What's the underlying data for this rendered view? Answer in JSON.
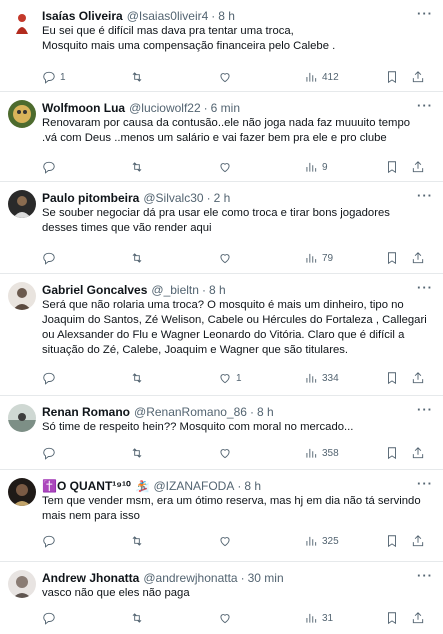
{
  "tweets": [
    {
      "name": "Isaías Oliveira",
      "handle": "@Isaias0liveir4",
      "time": "8 h",
      "lines": [
        "Eu sei que é difícil mas dava pra tentar uma troca,",
        "Mosquito mais uma compensação financeira pelo Calebe ."
      ],
      "replies": "1",
      "retweets": "",
      "likes": "",
      "views": "412",
      "avatar_color": "#b22b1e"
    },
    {
      "name": "Wolfmoon Lua",
      "handle": "@luciowolf22",
      "time": "6 min",
      "lines": [
        "Renovaram por causa da contusão..ele não joga nada faz muuuito tempo",
        ".vá com Deus ..menos um salário e vai fazer bem pra ele e pro clube"
      ],
      "replies": "",
      "retweets": "",
      "likes": "",
      "views": "9",
      "avatar_color": "#c7a04a"
    },
    {
      "name": "Paulo pitombeira",
      "handle": "@Silvalc30",
      "time": "2 h",
      "lines": [
        "Se souber negociar dá pra usar ele como troca e tirar bons jogadores",
        "desses times que vão render aqui"
      ],
      "replies": "",
      "retweets": "",
      "likes": "",
      "views": "79",
      "avatar_color": "#3a3a3a"
    },
    {
      "name": "Gabriel Goncalves",
      "handle": "@_bieltn",
      "time": "8 h",
      "lines": [
        "Será que não rolaria uma troca?  O mosquito é mais um dinheiro, tipo no",
        "Joaquim do Santos, Zé Welison, Cabele ou Hércules do Fortaleza , Callegari",
        "ou Alexsander do Flu e Wagner Leonardo do Vitória. Claro que é difícil a",
        "situação do Zé, Calebe, Joaquim e Wagner que são titulares."
      ],
      "replies": "",
      "retweets": "",
      "likes": "1",
      "views": "334",
      "avatar_color": "#6b5a4e"
    },
    {
      "name": "Renan Romano",
      "handle": "@RenanRomano_86",
      "time": "8 h",
      "lines": [
        "Só time de respeito hein?? Mosquito com moral no mercado..."
      ],
      "replies": "",
      "retweets": "",
      "likes": "",
      "views": "358",
      "avatar_color": "#7d8f86"
    },
    {
      "name": "✝️O QUANT¹⁹¹⁰",
      "handle": "@IZANAFODA",
      "time": "8 h",
      "emoji": "🏂",
      "lines": [
        "Tem que vender msm, era um ótimo reserva, mas hj em dia não tá servindo",
        "mais nem para isso"
      ],
      "replies": "",
      "retweets": "",
      "likes": "",
      "views": "325",
      "avatar_color": "#3b2a22"
    },
    {
      "name": "Andrew Jhonatta",
      "handle": "@andrewjhonatta",
      "time": "30 min",
      "lines": [
        "vasco não que eles não paga"
      ],
      "replies": "",
      "retweets": "",
      "likes": "",
      "views": "31",
      "avatar_color": "#8a7c74"
    }
  ]
}
